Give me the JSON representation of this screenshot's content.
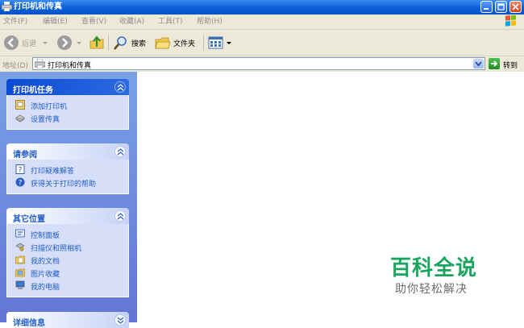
{
  "window": {
    "title": "打印机和传真"
  },
  "menubar": {
    "items": [
      "文件(F)",
      "编辑(E)",
      "查看(V)",
      "收藏(A)",
      "工具(T)",
      "帮助(H)"
    ]
  },
  "toolbar": {
    "back_label": "后退",
    "search_label": "搜索",
    "folders_label": "文件夹"
  },
  "address": {
    "label": "地址(D)",
    "value": "打印机和传真",
    "go_label": "转到"
  },
  "panels": [
    {
      "title": "打印机任务",
      "items": [
        {
          "label": "添加打印机",
          "icon": "add-printer-icon"
        },
        {
          "label": "设置传真",
          "icon": "fax-icon"
        }
      ]
    },
    {
      "title": "请参阅",
      "items": [
        {
          "label": "打印疑难解答",
          "icon": "help-book-icon"
        },
        {
          "label": "获得关于打印的帮助",
          "icon": "help-icon"
        }
      ]
    },
    {
      "title": "其它位置",
      "items": [
        {
          "label": "控制面板",
          "icon": "control-panel-icon"
        },
        {
          "label": "扫描仪和照相机",
          "icon": "scanner-icon"
        },
        {
          "label": "我的文档",
          "icon": "documents-folder-icon"
        },
        {
          "label": "图片收藏",
          "icon": "pictures-folder-icon"
        },
        {
          "label": "我的电脑",
          "icon": "computer-icon"
        }
      ]
    },
    {
      "title": "详细信息",
      "items": []
    }
  ],
  "watermark": {
    "title": "百科全说",
    "subtitle": "助你轻松解决"
  },
  "colors": {
    "title_bar": "#0a5fd8",
    "task_pane": "#6f8ddf",
    "link": "#215dc6",
    "watermark": "#1aa55f"
  }
}
